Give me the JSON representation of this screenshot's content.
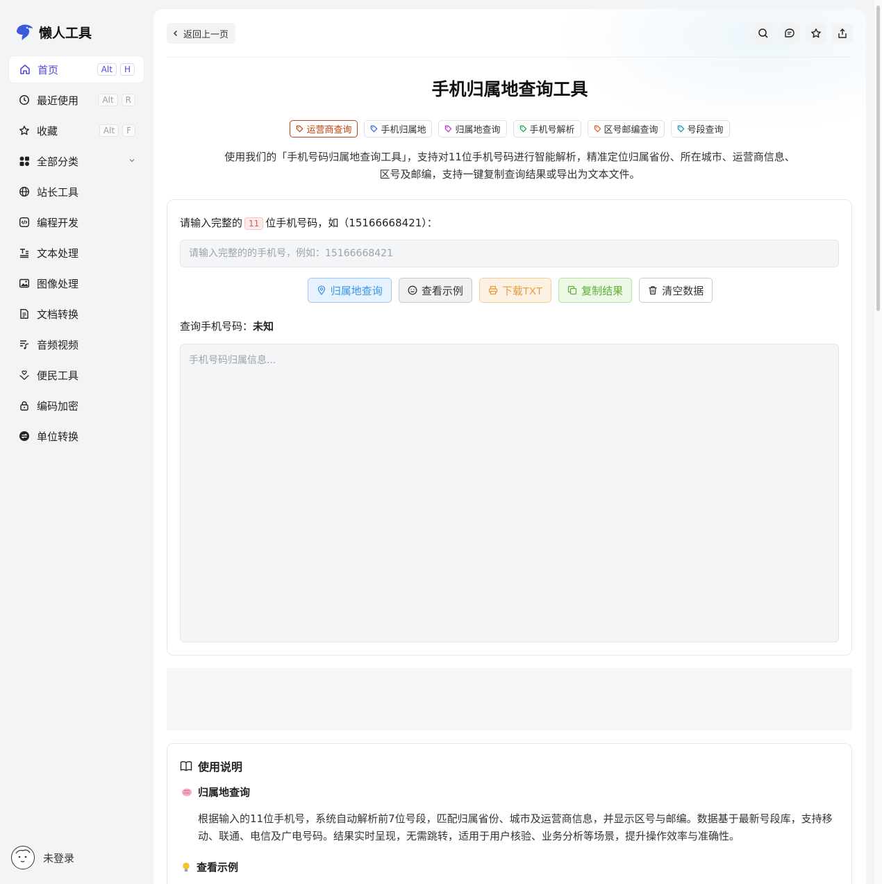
{
  "app": {
    "name": "懒人工具"
  },
  "sidebar": {
    "items": [
      {
        "label": "首页",
        "icon": "home-icon",
        "kbd": [
          "Alt",
          "H"
        ]
      },
      {
        "label": "最近使用",
        "icon": "clock-icon",
        "kbd": [
          "Alt",
          "R"
        ]
      },
      {
        "label": "收藏",
        "icon": "star-icon",
        "kbd": [
          "Alt",
          "F"
        ]
      },
      {
        "label": "全部分类",
        "icon": "grid-icon"
      },
      {
        "label": "站长工具",
        "icon": "globe-icon"
      },
      {
        "label": "编程开发",
        "icon": "code-icon"
      },
      {
        "label": "文本处理",
        "icon": "text-icon"
      },
      {
        "label": "图像处理",
        "icon": "image-icon"
      },
      {
        "label": "文档转换",
        "icon": "document-icon"
      },
      {
        "label": "音频视频",
        "icon": "media-icon"
      },
      {
        "label": "便民工具",
        "icon": "hand-heart-icon"
      },
      {
        "label": "编码加密",
        "icon": "lock-icon"
      },
      {
        "label": "单位转换",
        "icon": "exchange-icon"
      }
    ],
    "user_label": "未登录"
  },
  "topbar": {
    "back_label": "返回上一页",
    "icons": [
      "search-icon",
      "chat-icon",
      "star-icon",
      "share-icon"
    ]
  },
  "page": {
    "title": "手机归属地查询工具",
    "tags": [
      "运营商查询",
      "手机归属地",
      "归属地查询",
      "手机号解析",
      "区号邮编查询",
      "号段查询"
    ],
    "tag_colors": [
      "#c2410c",
      "#2563eb",
      "#c026d3",
      "#16a34a",
      "#ea580c",
      "#0891b2"
    ],
    "description": "使用我们的「手机号码归属地查询工具」，支持对11位手机号码进行智能解析，精准定位归属省份、所在城市、运营商信息、区号及邮编，支持一键复制查询结果或导出为文本文件。"
  },
  "form": {
    "label_before": "请输入完整的",
    "label_badge": "11",
    "label_after": "位手机号码，如（15166668421）：",
    "input_value": "",
    "input_placeholder": "请输入完整的的手机号，例如：15166668421",
    "buttons": [
      "归属地查询",
      "查看示例",
      "下载TXT",
      "复制结果",
      "清空数据"
    ],
    "result_label": "查询手机号码：",
    "result_value": "未知",
    "result_placeholder": "手机号码归属信息..."
  },
  "help": {
    "title": "使用说明",
    "section1_title": "归属地查询",
    "section1_text": "根据输入的11位手机号，系统自动解析前7位号段，匹配归属省份、城市及运营商信息，并显示区号与邮编。数据基于最新号段库，支持移动、联通、电信及广电号码。结果实时呈现，无需跳转，适用于用户核验、业务分析等场景，提升操作效率与准确性。",
    "section2_title": "查看示例"
  },
  "colors": {
    "accent": "#4f46e5",
    "brand": "#3b5bdb"
  }
}
